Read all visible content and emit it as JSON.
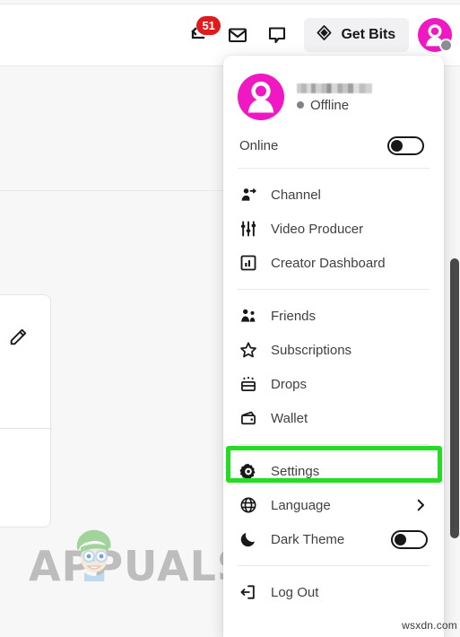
{
  "topbar": {
    "notifications": {
      "icon": "inbox-arrow-icon",
      "badge_count": "51"
    },
    "messages_icon": "envelope-icon",
    "whispers_icon": "chat-bubble-icon",
    "get_bits": {
      "label": "Get Bits",
      "icon": "bits-diamond-icon"
    },
    "avatar": {
      "icon": "user-avatar-icon",
      "color": "#ef18c3",
      "status_color": "#8c8c96"
    }
  },
  "menu": {
    "user": {
      "name_redacted": "",
      "status": "Offline",
      "avatar_icon": "user-avatar-icon",
      "avatar_color": "#ef18c3"
    },
    "online_toggle": {
      "label": "Online",
      "state": "off"
    },
    "groups": [
      {
        "items": [
          {
            "label": "Channel",
            "icon": "user-channel-icon"
          },
          {
            "label": "Video Producer",
            "icon": "sliders-icon"
          },
          {
            "label": "Creator Dashboard",
            "icon": "bar-chart-box-icon"
          }
        ]
      },
      {
        "items": [
          {
            "label": "Friends",
            "icon": "friends-icon"
          },
          {
            "label": "Subscriptions",
            "icon": "star-icon"
          },
          {
            "label": "Drops",
            "icon": "drops-chest-icon"
          },
          {
            "label": "Wallet",
            "icon": "wallet-icon"
          }
        ]
      },
      {
        "items": [
          {
            "label": "Settings",
            "icon": "gear-icon",
            "highlighted": true
          },
          {
            "label": "Language",
            "icon": "globe-icon",
            "accessory": "chevron-right-icon"
          },
          {
            "label": "Dark Theme",
            "icon": "moon-icon",
            "accessory": "toggle",
            "toggle_state": "off"
          }
        ]
      },
      {
        "items": [
          {
            "label": "Log Out",
            "icon": "logout-arrow-icon"
          }
        ]
      }
    ],
    "highlight_color": "#22dd22"
  },
  "page": {
    "brand_watermark": "APPUALS",
    "site_watermark": "wsxdn.com",
    "edit_icon": "pencil-icon"
  }
}
